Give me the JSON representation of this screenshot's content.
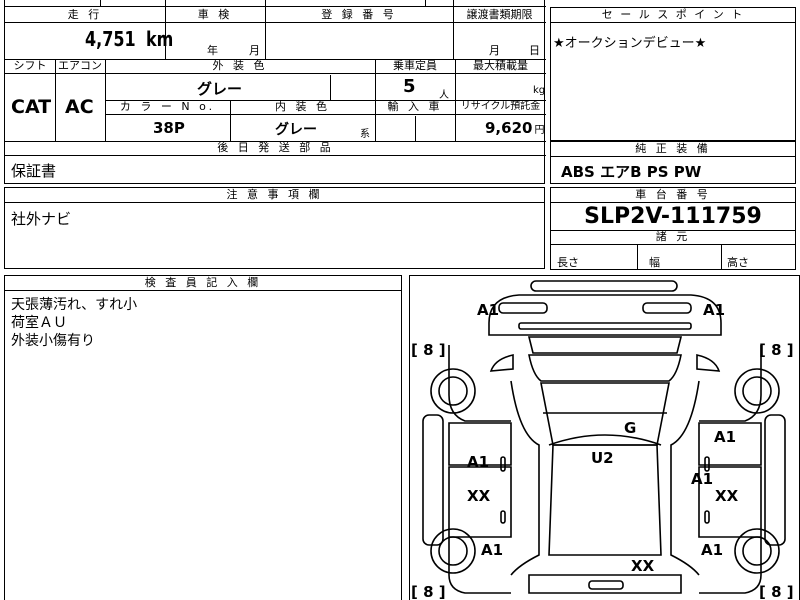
{
  "top_left": {
    "headers": {
      "mileage": "走 行",
      "inspection": "車 検",
      "registration": "登 録 番 号",
      "transfer_deadline": "譲渡書類期限",
      "shift": "シフト",
      "aircon": "エアコン",
      "exterior_color": "外 装 色",
      "capacity": "乗車定員",
      "max_load": "最大積載量",
      "color_no": "カ ラ ー N o.",
      "interior_color": "内 装 色",
      "import": "輸 入 車",
      "recycle": "リサイクル預託金",
      "post_parts": "後 日 発 送 部 品",
      "notes": "注 意 事 項 欄",
      "inspector": "検 査 員 記 入 欄"
    },
    "mileage_value": "4,751",
    "mileage_unit": "km",
    "inspection_year": "年",
    "inspection_month": "月",
    "deadline_month": "月",
    "deadline_day": "日",
    "shift_value": "CAT",
    "aircon_value": "AC",
    "exterior_color_value": "グレー",
    "capacity_value": "5",
    "capacity_unit": "人",
    "max_load_unit": "kg",
    "color_no_value": "38P",
    "interior_color_value": "グレー",
    "interior_suffix": "系",
    "recycle_value": "9,620",
    "recycle_unit": "円",
    "post_parts_value": "保証書",
    "notes_value": "社外ナビ",
    "inspector_lines": [
      "天張薄汚れ、すれ小",
      "荷室ＡＵ",
      "外装小傷有り"
    ]
  },
  "right": {
    "sales_point_header": "セ ー ル ス ポ イ ン ト",
    "sales_point_value": "★オークションデビュー★",
    "equipment_header": "純 正 装 備",
    "equipment_value": "ABS エアB PS PW",
    "chassis_header": "車 台 番 号",
    "chassis_value": "SLP2V-111759",
    "dimensions_header": "諸 元",
    "length_label": "長さ",
    "width_label": "幅",
    "height_label": "高さ"
  },
  "diagram": {
    "tire_labels": [
      "[ 8 ]",
      "[ 8 ]",
      "[ 8 ]",
      "[ 8 ]"
    ],
    "marks": [
      "A1",
      "A1",
      "G",
      "A1",
      "A1",
      "U2",
      "A1",
      "XX",
      "XX",
      "A1",
      "A1",
      "XX"
    ]
  }
}
